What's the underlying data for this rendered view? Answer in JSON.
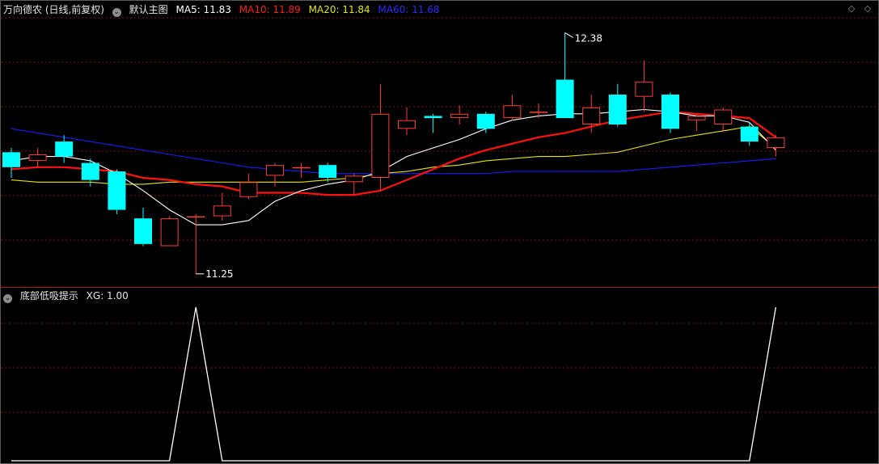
{
  "header": {
    "stock": "万向德农 (日线,前复权)",
    "template": "默认主图",
    "ma5_label": "MA5: 11.83",
    "ma10_label": "MA10: 11.89",
    "ma20_label": "MA20: 11.84",
    "ma60_label": "MA60: 11.68"
  },
  "subchart": {
    "title": "底部低吸提示",
    "xg_label": "XG: 1.00"
  },
  "colors": {
    "up": "#ff3b3b",
    "down": "#00ffff",
    "ma5": "#ffffff",
    "ma10": "#ff1010",
    "ma20": "#e6e600",
    "ma60": "#1a1aff",
    "grid": "#7a1010"
  },
  "icons": {
    "expand": "circle-chevron-icon",
    "settings": "diamond-icon"
  },
  "chart_data": [
    {
      "type": "candlestick",
      "title": "",
      "ylim": [
        11.2,
        12.45
      ],
      "annotations": {
        "high": "12.38",
        "low": "11.25"
      },
      "candles": [
        {
          "o": 11.82,
          "c": 11.75,
          "h": 11.84,
          "l": 11.7
        },
        {
          "o": 11.78,
          "c": 11.81,
          "h": 11.84,
          "l": 11.75
        },
        {
          "o": 11.87,
          "c": 11.8,
          "h": 11.9,
          "l": 11.77
        },
        {
          "o": 11.77,
          "c": 11.69,
          "h": 11.79,
          "l": 11.66
        },
        {
          "o": 11.73,
          "c": 11.55,
          "h": 11.74,
          "l": 11.53
        },
        {
          "o": 11.51,
          "c": 11.39,
          "h": 11.56,
          "l": 11.38
        },
        {
          "o": 11.38,
          "c": 11.51,
          "h": 11.52,
          "l": 11.38
        },
        {
          "o": 11.52,
          "c": 11.52,
          "h": 11.53,
          "l": 11.25
        },
        {
          "o": 11.52,
          "c": 11.57,
          "h": 11.63,
          "l": 11.5
        },
        {
          "o": 11.61,
          "c": 11.68,
          "h": 11.72,
          "l": 11.6
        },
        {
          "o": 11.71,
          "c": 11.76,
          "h": 11.77,
          "l": 11.66
        },
        {
          "o": 11.75,
          "c": 11.75,
          "h": 11.77,
          "l": 11.7
        },
        {
          "o": 11.76,
          "c": 11.7,
          "h": 11.77,
          "l": 11.68
        },
        {
          "o": 11.68,
          "c": 11.71,
          "h": 11.72,
          "l": 11.62
        },
        {
          "o": 11.7,
          "c": 12.0,
          "h": 12.14,
          "l": 11.64
        },
        {
          "o": 11.93,
          "c": 11.97,
          "h": 12.03,
          "l": 11.9
        },
        {
          "o": 11.99,
          "c": 11.98,
          "h": 12.0,
          "l": 11.91
        },
        {
          "o": 11.98,
          "c": 12.0,
          "h": 12.04,
          "l": 11.95
        },
        {
          "o": 12.0,
          "c": 11.93,
          "h": 12.01,
          "l": 11.91
        },
        {
          "o": 11.98,
          "c": 12.04,
          "h": 12.09,
          "l": 11.97
        },
        {
          "o": 12.01,
          "c": 12.01,
          "h": 12.05,
          "l": 11.98
        },
        {
          "o": 12.16,
          "c": 11.98,
          "h": 12.38,
          "l": 11.98
        },
        {
          "o": 11.95,
          "c": 12.03,
          "h": 12.09,
          "l": 11.91
        },
        {
          "o": 12.09,
          "c": 11.95,
          "h": 12.14,
          "l": 11.94
        },
        {
          "o": 12.08,
          "c": 12.15,
          "h": 12.25,
          "l": 12.01
        },
        {
          "o": 12.09,
          "c": 11.93,
          "h": 12.1,
          "l": 11.91
        },
        {
          "o": 11.97,
          "c": 11.99,
          "h": 12.0,
          "l": 11.92
        },
        {
          "o": 11.95,
          "c": 12.02,
          "h": 12.03,
          "l": 11.92
        },
        {
          "o": 11.94,
          "c": 11.87,
          "h": 11.96,
          "l": 11.85
        },
        {
          "o": 11.84,
          "c": 11.89,
          "h": 11.9,
          "l": 11.8
        }
      ],
      "series": [
        {
          "name": "MA5",
          "values": [
            11.78,
            11.8,
            11.8,
            11.78,
            11.72,
            11.64,
            11.55,
            11.48,
            11.48,
            11.5,
            11.59,
            11.64,
            11.67,
            11.69,
            11.73,
            11.8,
            11.84,
            11.88,
            11.93,
            11.97,
            11.99,
            12.0,
            12.0,
            12.01,
            12.02,
            12.01,
            11.99,
            11.99,
            11.96,
            11.83
          ]
        },
        {
          "name": "MA10",
          "values": [
            11.74,
            11.75,
            11.75,
            11.74,
            11.73,
            11.7,
            11.69,
            11.67,
            11.66,
            11.63,
            11.63,
            11.63,
            11.62,
            11.62,
            11.64,
            11.69,
            11.74,
            11.79,
            11.83,
            11.86,
            11.89,
            11.91,
            11.94,
            11.97,
            11.99,
            12.01,
            12.0,
            11.99,
            11.98,
            11.89
          ]
        },
        {
          "name": "MA20",
          "values": [
            11.69,
            11.68,
            11.68,
            11.68,
            11.67,
            11.67,
            11.68,
            11.68,
            11.68,
            11.68,
            11.68,
            11.68,
            11.69,
            11.7,
            11.72,
            11.73,
            11.75,
            11.76,
            11.78,
            11.79,
            11.8,
            11.8,
            11.81,
            11.82,
            11.85,
            11.88,
            11.9,
            11.92,
            11.94,
            11.84
          ]
        },
        {
          "name": "MA60",
          "values": [
            11.93,
            11.91,
            11.89,
            11.87,
            11.85,
            11.83,
            11.81,
            11.79,
            11.77,
            11.75,
            11.74,
            11.73,
            11.72,
            11.72,
            11.72,
            11.72,
            11.72,
            11.72,
            11.72,
            11.73,
            11.73,
            11.73,
            11.73,
            11.73,
            11.74,
            11.75,
            11.76,
            11.77,
            11.78,
            11.79
          ]
        }
      ]
    },
    {
      "type": "line",
      "title": "底部低吸提示",
      "series": [
        {
          "name": "XG",
          "values": [
            0,
            0,
            0,
            0,
            0,
            0,
            0,
            1,
            0,
            0,
            0,
            0,
            0,
            0,
            0,
            0,
            0,
            0,
            0,
            0,
            0,
            0,
            0,
            0,
            0,
            0,
            0,
            0,
            0,
            1
          ]
        }
      ],
      "ylim": [
        0,
        1
      ]
    }
  ]
}
